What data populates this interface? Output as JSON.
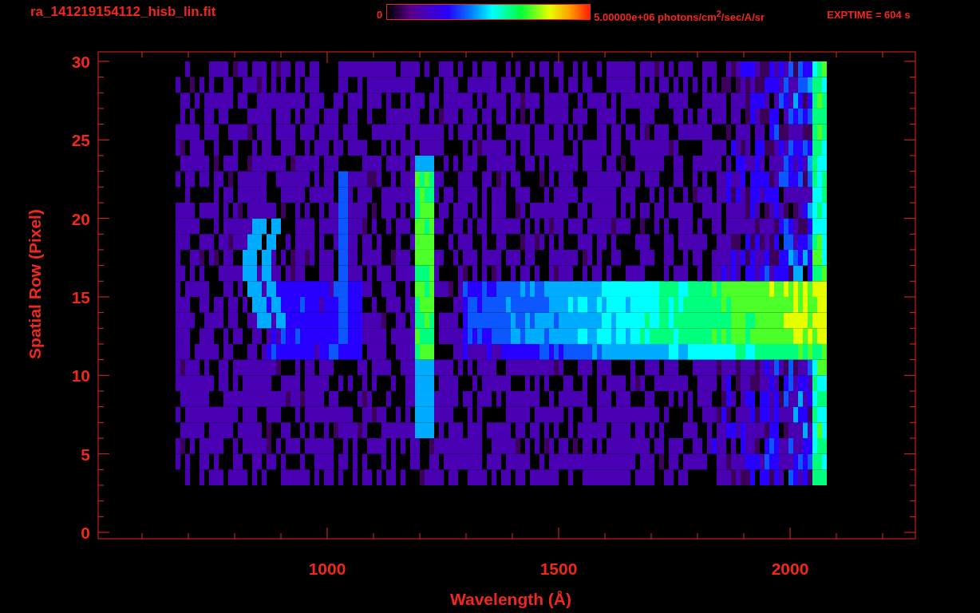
{
  "title": "ra_141219154112_hisb_lin.fit",
  "colorbar": {
    "min_label": "0",
    "max_label": "5.00000e+06 photons/cm$^{2}$/sec/A/sr"
  },
  "exposure": "EXPTIME = 604 s",
  "x_axis": {
    "title": "Wavelength (Å)",
    "ticks": [
      {
        "label": "1000"
      },
      {
        "label": "1500"
      },
      {
        "label": "2000"
      }
    ]
  },
  "y_axis": {
    "title": "Spatial Row (Pixel)",
    "ticks": [
      {
        "label": "30"
      },
      {
        "label": "25"
      },
      {
        "label": "20"
      },
      {
        "label": "15"
      },
      {
        "label": "10"
      },
      {
        "label": "5"
      },
      {
        "label": "0"
      }
    ]
  }
}
